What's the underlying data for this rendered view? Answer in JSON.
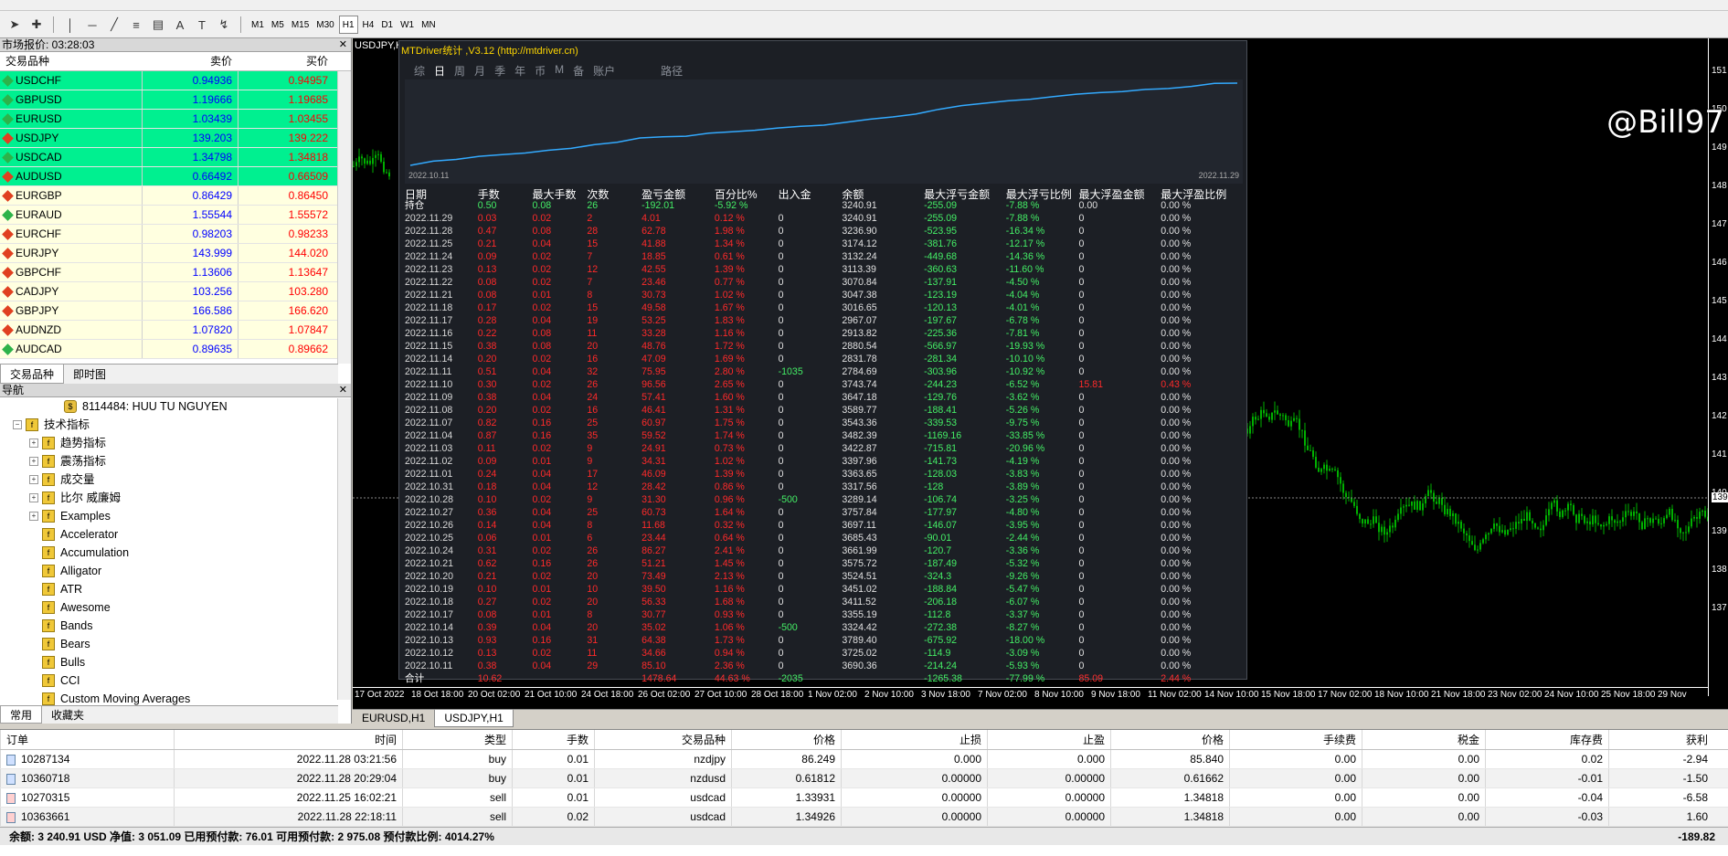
{
  "market_watch": {
    "title": "市场报价: 03:28:03",
    "headers": {
      "symbol": "交易品种",
      "bid": "卖价",
      "ask": "买价"
    },
    "rows": [
      {
        "symbol": "USDCHF",
        "bid": "0.94936",
        "ask": "0.94957",
        "hl": true,
        "up": true
      },
      {
        "symbol": "GBPUSD",
        "bid": "1.19666",
        "ask": "1.19685",
        "hl": true,
        "up": true
      },
      {
        "symbol": "EURUSD",
        "bid": "1.03439",
        "ask": "1.03455",
        "hl": true,
        "up": true
      },
      {
        "symbol": "USDJPY",
        "bid": "139.203",
        "ask": "139.222",
        "hl": true,
        "up": false
      },
      {
        "symbol": "USDCAD",
        "bid": "1.34798",
        "ask": "1.34818",
        "hl": true,
        "up": true
      },
      {
        "symbol": "AUDUSD",
        "bid": "0.66492",
        "ask": "0.66509",
        "hl": true,
        "up": false
      },
      {
        "symbol": "EURGBP",
        "bid": "0.86429",
        "ask": "0.86450",
        "hl": false,
        "up": false
      },
      {
        "symbol": "EURAUD",
        "bid": "1.55544",
        "ask": "1.55572",
        "hl": false,
        "up": true
      },
      {
        "symbol": "EURCHF",
        "bid": "0.98203",
        "ask": "0.98233",
        "hl": false,
        "up": false
      },
      {
        "symbol": "EURJPY",
        "bid": "143.999",
        "ask": "144.020",
        "hl": false,
        "up": false
      },
      {
        "symbol": "GBPCHF",
        "bid": "1.13606",
        "ask": "1.13647",
        "hl": false,
        "up": false
      },
      {
        "symbol": "CADJPY",
        "bid": "103.256",
        "ask": "103.280",
        "hl": false,
        "up": false
      },
      {
        "symbol": "GBPJPY",
        "bid": "166.586",
        "ask": "166.620",
        "hl": false,
        "up": false
      },
      {
        "symbol": "AUDNZD",
        "bid": "1.07820",
        "ask": "1.07847",
        "hl": false,
        "up": false
      },
      {
        "symbol": "AUDCAD",
        "bid": "0.89635",
        "ask": "0.89662",
        "hl": false,
        "up": true
      }
    ],
    "tabs": [
      "交易品种",
      "即时图"
    ]
  },
  "navigator": {
    "title": "导航",
    "account": "8114484: HUU TU NGUYEN",
    "items": [
      {
        "label": "技术指标",
        "level": 0,
        "folder": true
      },
      {
        "label": "趋势指标",
        "level": 1,
        "folder": true
      },
      {
        "label": "震荡指标",
        "level": 1,
        "folder": true
      },
      {
        "label": "成交量",
        "level": 1,
        "folder": true
      },
      {
        "label": "比尔 威廉姆",
        "level": 1,
        "folder": true
      },
      {
        "label": "Examples",
        "level": 1,
        "folder": true
      },
      {
        "label": "Accelerator",
        "level": 1,
        "folder": false
      },
      {
        "label": "Accumulation",
        "level": 1,
        "folder": false
      },
      {
        "label": "Alligator",
        "level": 1,
        "folder": false
      },
      {
        "label": "ATR",
        "level": 1,
        "folder": false
      },
      {
        "label": "Awesome",
        "level": 1,
        "folder": false
      },
      {
        "label": "Bands",
        "level": 1,
        "folder": false
      },
      {
        "label": "Bears",
        "level": 1,
        "folder": false
      },
      {
        "label": "Bulls",
        "level": 1,
        "folder": false
      },
      {
        "label": "CCI",
        "level": 1,
        "folder": false
      },
      {
        "label": "Custom Moving Averages",
        "level": 1,
        "folder": false
      }
    ],
    "tabs": [
      "常用",
      "收藏夹"
    ]
  },
  "toolbar": {
    "timeframes": [
      "M1",
      "M5",
      "M15",
      "M30",
      "H1",
      "H4",
      "D1",
      "W1",
      "MN"
    ],
    "active_timeframe": "H1"
  },
  "chart": {
    "symbol_label": "USDJPY,H1",
    "price_ticks": [
      "151",
      "150",
      "149",
      "148",
      "147",
      "146",
      "145",
      "144",
      "143",
      "142",
      "141",
      "140",
      "139",
      "138",
      "137"
    ],
    "current_price": "139",
    "time_ticks": [
      "17 Oct 2022",
      "18 Oct 18:00",
      "20 Oct 02:00",
      "21 Oct 10:00",
      "24 Oct 18:00",
      "26 Oct 02:00",
      "27 Oct 10:00",
      "28 Oct 18:00",
      "1 Nov 02:00",
      "2 Nov 10:00",
      "3 Nov 18:00",
      "7 Nov 02:00",
      "8 Nov 10:00",
      "9 Nov 18:00",
      "11 Nov 02:00",
      "14 Nov 10:00",
      "15 Nov 18:00",
      "17 Nov 02:00",
      "18 Nov 10:00",
      "21 Nov 18:00",
      "23 Nov 02:00",
      "24 Nov 10:00",
      "25 Nov 18:00",
      "29 Nov"
    ],
    "tabs": [
      "EURUSD,H1",
      "USDJPY,H1"
    ],
    "active_tab": "USDJPY,H1",
    "watermark": "@Bill97"
  },
  "stats": {
    "header": "MTDriver统计 ,V3.12 (http://mtdriver.cn)",
    "tabs": [
      "综",
      "日",
      "周",
      "月",
      "季",
      "年",
      "币",
      "M",
      "备",
      "账户",
      "路径"
    ],
    "active_tab": "日",
    "equity_start": "2022.10.11",
    "equity_end": "2022.11.29",
    "columns": [
      "日期",
      "手数",
      "最大手数",
      "次数",
      "盈亏金额",
      "百分比%",
      "出入金",
      "余额",
      "最大浮亏金额",
      "最大浮亏比例",
      "最大浮盈金额",
      "最大浮盈比例"
    ],
    "holding": [
      "持仓",
      "0.50",
      "0.08",
      "26",
      "-192.01",
      "-5.92 %",
      "",
      "3240.91",
      "-255.09",
      "-7.88 %",
      "0.00",
      "0.00 %"
    ],
    "rows": [
      [
        "2022.11.29",
        "0.03",
        "0.02",
        "2",
        "4.01",
        "0.12 %",
        "0",
        "3240.91",
        "-255.09",
        "-7.88 %",
        "0",
        "0.00 %"
      ],
      [
        "2022.11.28",
        "0.47",
        "0.08",
        "28",
        "62.78",
        "1.98 %",
        "0",
        "3236.90",
        "-523.95",
        "-16.34 %",
        "0",
        "0.00 %"
      ],
      [
        "2022.11.25",
        "0.21",
        "0.04",
        "15",
        "41.88",
        "1.34 %",
        "0",
        "3174.12",
        "-381.76",
        "-12.17 %",
        "0",
        "0.00 %"
      ],
      [
        "2022.11.24",
        "0.09",
        "0.02",
        "7",
        "18.85",
        "0.61 %",
        "0",
        "3132.24",
        "-449.68",
        "-14.36 %",
        "0",
        "0.00 %"
      ],
      [
        "2022.11.23",
        "0.13",
        "0.02",
        "12",
        "42.55",
        "1.39 %",
        "0",
        "3113.39",
        "-360.63",
        "-11.60 %",
        "0",
        "0.00 %"
      ],
      [
        "2022.11.22",
        "0.08",
        "0.02",
        "7",
        "23.46",
        "0.77 %",
        "0",
        "3070.84",
        "-137.91",
        "-4.50 %",
        "0",
        "0.00 %"
      ],
      [
        "2022.11.21",
        "0.08",
        "0.01",
        "8",
        "30.73",
        "1.02 %",
        "0",
        "3047.38",
        "-123.19",
        "-4.04 %",
        "0",
        "0.00 %"
      ],
      [
        "2022.11.18",
        "0.17",
        "0.02",
        "15",
        "49.58",
        "1.67 %",
        "0",
        "3016.65",
        "-120.13",
        "-4.01 %",
        "0",
        "0.00 %"
      ],
      [
        "2022.11.17",
        "0.28",
        "0.04",
        "19",
        "53.25",
        "1.83 %",
        "0",
        "2967.07",
        "-197.67",
        "-6.78 %",
        "0",
        "0.00 %"
      ],
      [
        "2022.11.16",
        "0.22",
        "0.08",
        "11",
        "33.28",
        "1.16 %",
        "0",
        "2913.82",
        "-225.36",
        "-7.81 %",
        "0",
        "0.00 %"
      ],
      [
        "2022.11.15",
        "0.38",
        "0.08",
        "20",
        "48.76",
        "1.72 %",
        "0",
        "2880.54",
        "-566.97",
        "-19.93 %",
        "0",
        "0.00 %"
      ],
      [
        "2022.11.14",
        "0.20",
        "0.02",
        "16",
        "47.09",
        "1.69 %",
        "0",
        "2831.78",
        "-281.34",
        "-10.10 %",
        "0",
        "0.00 %"
      ],
      [
        "2022.11.11",
        "0.51",
        "0.04",
        "32",
        "75.95",
        "2.80 %",
        "-1035",
        "2784.69",
        "-303.96",
        "-10.92 %",
        "0",
        "0.00 %"
      ],
      [
        "2022.11.10",
        "0.30",
        "0.02",
        "26",
        "96.56",
        "2.65 %",
        "0",
        "3743.74",
        "-244.23",
        "-6.52 %",
        "15.81",
        "0.43 %"
      ],
      [
        "2022.11.09",
        "0.38",
        "0.04",
        "24",
        "57.41",
        "1.60 %",
        "0",
        "3647.18",
        "-129.76",
        "-3.62 %",
        "0",
        "0.00 %"
      ],
      [
        "2022.11.08",
        "0.20",
        "0.02",
        "16",
        "46.41",
        "1.31 %",
        "0",
        "3589.77",
        "-188.41",
        "-5.26 %",
        "0",
        "0.00 %"
      ],
      [
        "2022.11.07",
        "0.82",
        "0.16",
        "25",
        "60.97",
        "1.75 %",
        "0",
        "3543.36",
        "-339.53",
        "-9.75 %",
        "0",
        "0.00 %"
      ],
      [
        "2022.11.04",
        "0.87",
        "0.16",
        "35",
        "59.52",
        "1.74 %",
        "0",
        "3482.39",
        "-1169.16",
        "-33.85 %",
        "0",
        "0.00 %"
      ],
      [
        "2022.11.03",
        "0.11",
        "0.02",
        "9",
        "24.91",
        "0.73 %",
        "0",
        "3422.87",
        "-715.81",
        "-20.96 %",
        "0",
        "0.00 %"
      ],
      [
        "2022.11.02",
        "0.09",
        "0.01",
        "9",
        "34.31",
        "1.02 %",
        "0",
        "3397.96",
        "-141.73",
        "-4.19 %",
        "0",
        "0.00 %"
      ],
      [
        "2022.11.01",
        "0.24",
        "0.04",
        "17",
        "46.09",
        "1.39 %",
        "0",
        "3363.65",
        "-128.03",
        "-3.83 %",
        "0",
        "0.00 %"
      ],
      [
        "2022.10.31",
        "0.18",
        "0.04",
        "12",
        "28.42",
        "0.86 %",
        "0",
        "3317.56",
        "-128",
        "-3.89 %",
        "0",
        "0.00 %"
      ],
      [
        "2022.10.28",
        "0.10",
        "0.02",
        "9",
        "31.30",
        "0.96 %",
        "-500",
        "3289.14",
        "-106.74",
        "-3.25 %",
        "0",
        "0.00 %"
      ],
      [
        "2022.10.27",
        "0.36",
        "0.04",
        "25",
        "60.73",
        "1.64 %",
        "0",
        "3757.84",
        "-177.97",
        "-4.80 %",
        "0",
        "0.00 %"
      ],
      [
        "2022.10.26",
        "0.14",
        "0.04",
        "8",
        "11.68",
        "0.32 %",
        "0",
        "3697.11",
        "-146.07",
        "-3.95 %",
        "0",
        "0.00 %"
      ],
      [
        "2022.10.25",
        "0.06",
        "0.01",
        "6",
        "23.44",
        "0.64 %",
        "0",
        "3685.43",
        "-90.01",
        "-2.44 %",
        "0",
        "0.00 %"
      ],
      [
        "2022.10.24",
        "0.31",
        "0.02",
        "26",
        "86.27",
        "2.41 %",
        "0",
        "3661.99",
        "-120.7",
        "-3.36 %",
        "0",
        "0.00 %"
      ],
      [
        "2022.10.21",
        "0.62",
        "0.16",
        "26",
        "51.21",
        "1.45 %",
        "0",
        "3575.72",
        "-187.49",
        "-5.32 %",
        "0",
        "0.00 %"
      ],
      [
        "2022.10.20",
        "0.21",
        "0.02",
        "20",
        "73.49",
        "2.13 %",
        "0",
        "3524.51",
        "-324.3",
        "-9.26 %",
        "0",
        "0.00 %"
      ],
      [
        "2022.10.19",
        "0.10",
        "0.01",
        "10",
        "39.50",
        "1.16 %",
        "0",
        "3451.02",
        "-188.84",
        "-5.47 %",
        "0",
        "0.00 %"
      ],
      [
        "2022.10.18",
        "0.27",
        "0.02",
        "20",
        "56.33",
        "1.68 %",
        "0",
        "3411.52",
        "-206.18",
        "-6.07 %",
        "0",
        "0.00 %"
      ],
      [
        "2022.10.17",
        "0.08",
        "0.01",
        "8",
        "30.77",
        "0.93 %",
        "0",
        "3355.19",
        "-112.8",
        "-3.37 %",
        "0",
        "0.00 %"
      ],
      [
        "2022.10.14",
        "0.39",
        "0.04",
        "20",
        "35.02",
        "1.06 %",
        "-500",
        "3324.42",
        "-272.38",
        "-8.27 %",
        "0",
        "0.00 %"
      ],
      [
        "2022.10.13",
        "0.93",
        "0.16",
        "31",
        "64.38",
        "1.73 %",
        "0",
        "3789.40",
        "-675.92",
        "-18.00 %",
        "0",
        "0.00 %"
      ],
      [
        "2022.10.12",
        "0.13",
        "0.02",
        "11",
        "34.66",
        "0.94 %",
        "0",
        "3725.02",
        "-114.9",
        "-3.09 %",
        "0",
        "0.00 %"
      ],
      [
        "2022.10.11",
        "0.38",
        "0.04",
        "29",
        "85.10",
        "2.36 %",
        "0",
        "3690.36",
        "-214.24",
        "-5.93 %",
        "0",
        "0.00 %"
      ]
    ],
    "total": [
      "合计",
      "10.62",
      "",
      "",
      "1478.64",
      "44.63 %",
      "-2035",
      "",
      "-1265.38",
      "-77.99 %",
      "85.09",
      "2.44 %"
    ]
  },
  "orders": {
    "columns": [
      "订单",
      "时间",
      "类型",
      "手数",
      "交易品种",
      "价格",
      "止损",
      "止盈",
      "价格",
      "手续费",
      "税金",
      "库存费",
      "获利"
    ],
    "rows": [
      [
        "10287134",
        "2022.11.28 03:21:56",
        "buy",
        "0.01",
        "nzdjpy",
        "86.249",
        "0.000",
        "0.000",
        "85.840",
        "0.00",
        "0.00",
        "0.02",
        "-2.94"
      ],
      [
        "10360718",
        "2022.11.28 20:29:04",
        "buy",
        "0.01",
        "nzdusd",
        "0.61812",
        "0.00000",
        "0.00000",
        "0.61662",
        "0.00",
        "0.00",
        "-0.01",
        "-1.50"
      ],
      [
        "10270315",
        "2022.11.25 16:02:21",
        "sell",
        "0.01",
        "usdcad",
        "1.33931",
        "0.00000",
        "0.00000",
        "1.34818",
        "0.00",
        "0.00",
        "-0.04",
        "-6.58"
      ],
      [
        "10363661",
        "2022.11.28 22:18:11",
        "sell",
        "0.02",
        "usdcad",
        "1.34926",
        "0.00000",
        "0.00000",
        "1.34818",
        "0.00",
        "0.00",
        "-0.03",
        "1.60"
      ]
    ],
    "summary": "余额: 3 240.91 USD  净值: 3 051.09  已用预付款: 76.01  可用预付款: 2 975.08  预付款比例: 4014.27%",
    "summary_profit": "-189.82"
  },
  "colors": {
    "highlight": "#00f090",
    "normal_row": "#ffffe0",
    "up_diamond": "#2db34a",
    "down_diamond": "#e04020",
    "bid_blue": "#0000ff",
    "ask_red": "#ff0000",
    "candle_green": "#00b000",
    "equity_line": "#33aaff"
  }
}
